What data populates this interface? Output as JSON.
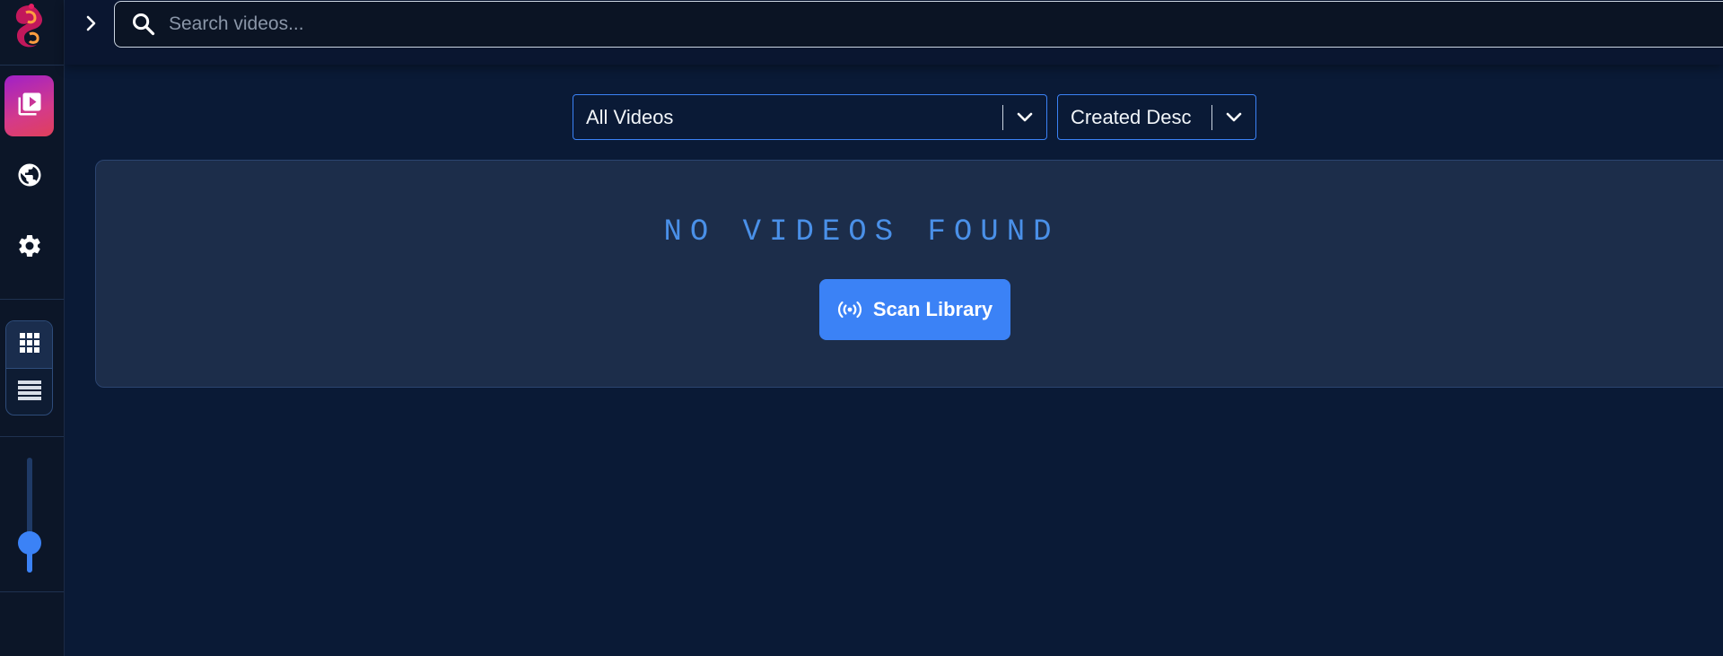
{
  "search": {
    "placeholder": "Search videos..."
  },
  "filters": {
    "category": {
      "selected": "All Videos"
    },
    "sort": {
      "selected": "Created Desc"
    }
  },
  "empty_state": {
    "title": "NO VIDEOS FOUND",
    "action_label": "Scan Library"
  },
  "sidebar": {
    "nav": [
      {
        "icon": "video-library-icon",
        "active": true
      },
      {
        "icon": "globe-icon",
        "active": false
      },
      {
        "icon": "gear-icon",
        "active": false
      }
    ],
    "view_modes": [
      {
        "icon": "grid-view-icon",
        "active": true
      },
      {
        "icon": "list-view-icon",
        "active": false
      }
    ],
    "zoom_level": 0.2
  },
  "colors": {
    "accent": "#3b82f6",
    "background": "#0a1a36",
    "panel": "#1c2d4a",
    "active_nav_gradient": [
      "#a020c8",
      "#e0405a"
    ]
  }
}
